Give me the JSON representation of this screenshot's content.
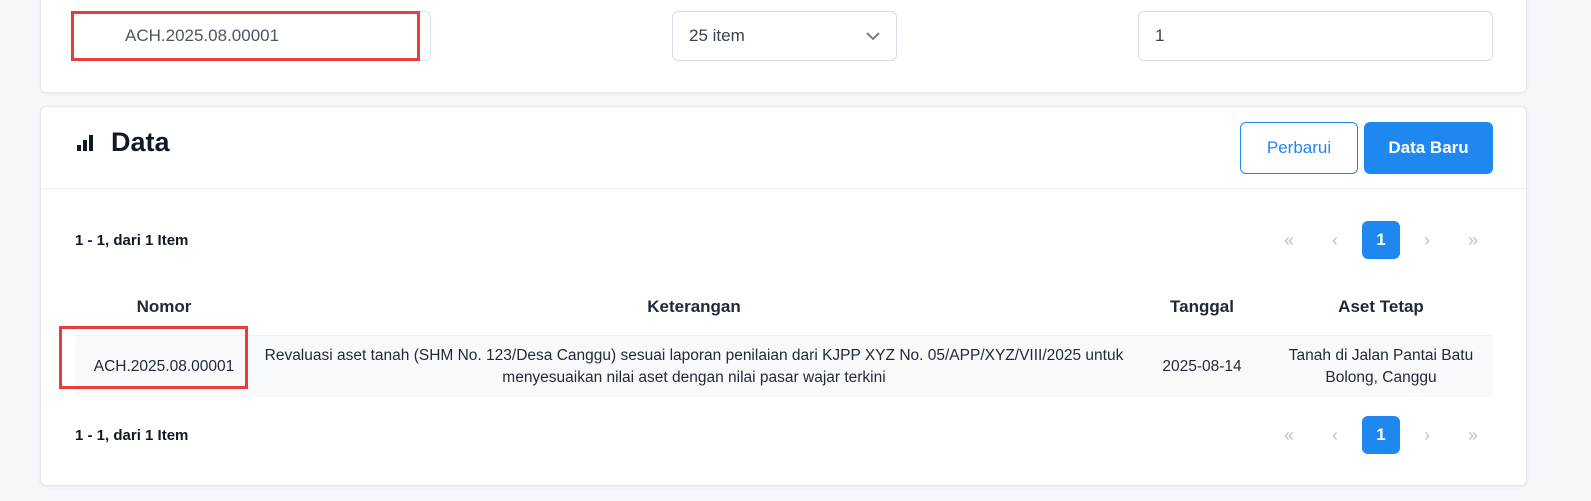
{
  "filter": {
    "search_value": "ACH.2025.08.00001",
    "per_page": "25 item",
    "page_value": "1"
  },
  "data_section": {
    "title": "Data",
    "refresh_label": "Perbarui",
    "new_label": "Data Baru"
  },
  "pagination": {
    "summary": "1 - 1, dari 1 Item",
    "first": "«",
    "prev": "‹",
    "current": "1",
    "next": "›",
    "last": "»"
  },
  "table": {
    "headers": [
      "Nomor",
      "Keterangan",
      "Tanggal",
      "Aset Tetap"
    ],
    "rows": [
      {
        "nomor": "ACH.2025.08.00001",
        "keterangan": "Revaluasi aset tanah (SHM No. 123/Desa Canggu) sesuai laporan penilaian dari KJPP XYZ No. 05/APP/XYZ/VIII/2025 untuk menyesuaikan nilai aset dengan nilai pasar wajar terkini",
        "tanggal": "2025-08-14",
        "aset_tetap": "Tanah di Jalan Pantai Batu Bolong, Canggu"
      }
    ]
  },
  "colors": {
    "primary": "#1e88f0",
    "highlight": "#e53e3e"
  }
}
